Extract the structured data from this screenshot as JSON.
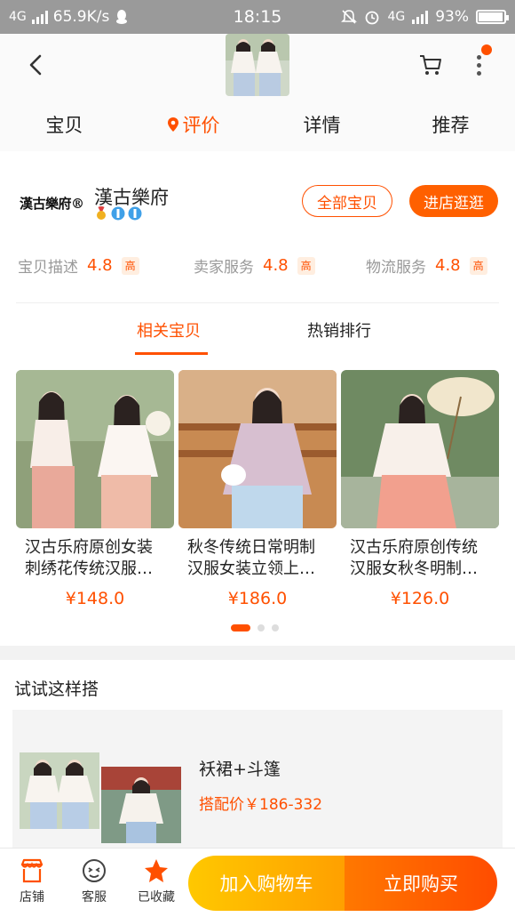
{
  "status_bar": {
    "network_left": "4G",
    "speed": "65.9K/s",
    "time": "18:15",
    "network_right": "4G",
    "battery": "93%"
  },
  "header": {
    "tabs": [
      {
        "label": "宝贝"
      },
      {
        "label": "评价"
      },
      {
        "label": "详情"
      },
      {
        "label": "推荐"
      }
    ]
  },
  "shop": {
    "logo_text": "漢古樂府®",
    "name": "漢古樂府",
    "all_items_label": "全部宝贝",
    "enter_shop_label": "进店逛逛",
    "ratings": [
      {
        "label": "宝贝描述",
        "score": "4.8",
        "level": "高"
      },
      {
        "label": "卖家服务",
        "score": "4.8",
        "level": "高"
      },
      {
        "label": "物流服务",
        "score": "4.8",
        "level": "高"
      }
    ],
    "subtabs": [
      {
        "label": "相关宝贝"
      },
      {
        "label": "热销排行"
      }
    ],
    "products": [
      {
        "title": "汉古乐府原创女装刺绣花传统汉服上襦下裙",
        "price": "¥148.0"
      },
      {
        "title": "秋冬传统日常明制汉服女装立领上衣马面裙",
        "price": "¥186.0"
      },
      {
        "title": "汉古乐府原创传统汉服女秋冬明制长裙套装",
        "price": "¥126.0"
      }
    ]
  },
  "outfit": {
    "section_title": "试试这样搭",
    "name": "袄裙+斗篷",
    "price": "搭配价￥186-332"
  },
  "bottom_bar": {
    "shop_label": "店铺",
    "service_label": "客服",
    "favorite_label": "已收藏",
    "add_to_cart_label": "加入购物车",
    "buy_now_label": "立即购买"
  },
  "colors": {
    "accent": "#ff5000",
    "cart_gradient_start": "#ffc800",
    "buy_gradient_start": "#ff7800"
  }
}
